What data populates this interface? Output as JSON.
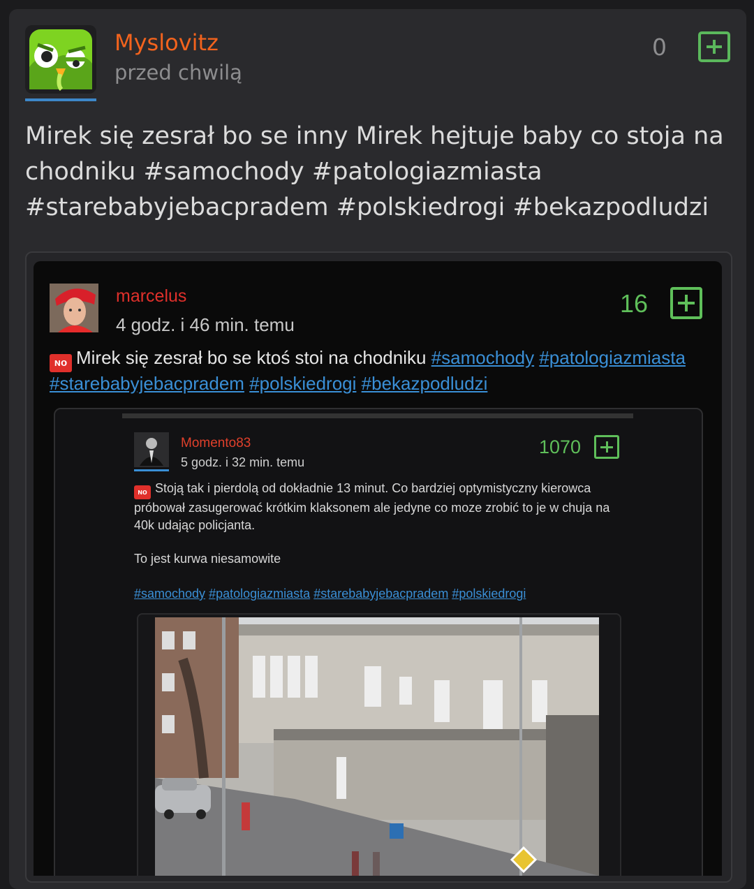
{
  "post": {
    "author": "Myslovitz",
    "time": "przed chwilą",
    "votes": "0",
    "text": "Mirek się zesrał bo se inny Mirek hejtuje baby co stoja na chodniku #samochody #patologiazmiasta #starebabyjebacpradem #polskiedrogi #bekazpodludzi"
  },
  "embedded_post": {
    "author": "marcelus",
    "time": "4 godz. i 46 min. temu",
    "votes": "16",
    "badge": "ɴᴏ",
    "text": "Mirek się zesrał bo se ktoś stoi na chodniku",
    "tags": [
      "#samochody",
      "#patologiazmiasta",
      "#starebabyjebacpradem",
      "#polskiedrogi",
      "#bekazpodludzi"
    ]
  },
  "nested_post": {
    "author": "Momento83",
    "time": "5 godz. i 32 min. temu",
    "votes": "1070",
    "badge": "ɴᴏ",
    "text": "Stoją tak i pierdolą od dokładnie 13 minut. Co bardziej optymistyczny kierowca próbował zasugerować krótkim klaksonem ale jedyne co moze zrobić to je w chuja na 40k udając policjanta.",
    "text2": "To jest kurwa niesamowite",
    "tags": [
      "#samochody",
      "#patologiazmiasta",
      "#starebabyjebacpradem",
      "#polskiedrogi"
    ]
  },
  "colors": {
    "author": "#f3631d",
    "vote_green": "#5bb85c",
    "tag_link": "#3a8fd6"
  },
  "icons": [
    "avatar-owl-icon",
    "plus-vote-icon",
    "nsfw-badge-icon"
  ]
}
